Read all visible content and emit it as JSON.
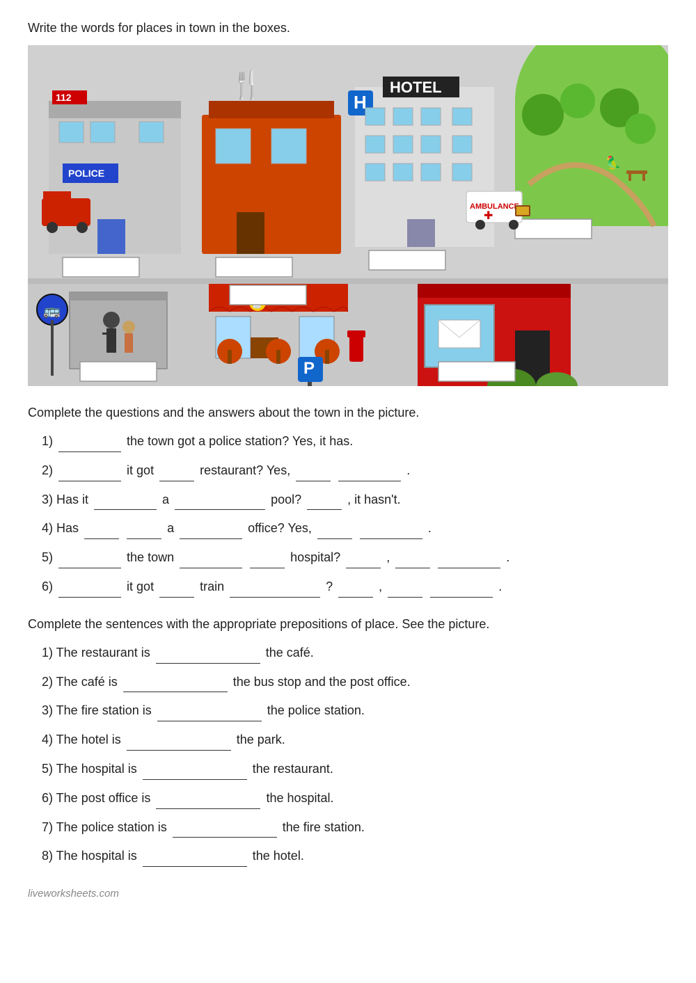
{
  "page": {
    "instruction1": "Write the words for places in town in the boxes.",
    "instruction2": "Complete the questions and the answers about the town in the picture.",
    "instruction3": "Complete the sentences with the appropriate prepositions of place. See the picture.",
    "footer": "liveworksheets.com"
  },
  "questions": [
    {
      "num": "1)",
      "text": "_________ the town got a police station?  Yes, it has."
    },
    {
      "num": "2)",
      "text": "_________ it got ____ restaurant? Yes, ____ _________."
    },
    {
      "num": "3)",
      "text": "Has it _________ a _______________ pool? _____, it hasn't."
    },
    {
      "num": "4)",
      "text": "Has _____ _______ a _________ office? Yes, ____ _________."
    },
    {
      "num": "5)",
      "text": "_________ the town _________ _____ hospital? _____, ____ _________."
    },
    {
      "num": "6)",
      "text": "_________ it got _____ train ___________ ? _____, ____ _________."
    }
  ],
  "sentences": [
    {
      "num": "1)",
      "text_before": "The restaurant is",
      "blank_size": "xl",
      "text_after": "the café."
    },
    {
      "num": "2)",
      "text_before": "The café is",
      "blank_size": "xl",
      "text_after": "the bus stop and the post office."
    },
    {
      "num": "3)",
      "text_before": "The fire station is",
      "blank_size": "xl",
      "text_after": "the police station."
    },
    {
      "num": "4)",
      "text_before": "The hotel is",
      "blank_size": "xl",
      "text_after": "the park."
    },
    {
      "num": "5)",
      "text_before": "The hospital is",
      "blank_size": "xl",
      "text_after": "the restaurant."
    },
    {
      "num": "6)",
      "text_before": "The post office is",
      "blank_size": "xl",
      "text_after": "the hospital."
    },
    {
      "num": "7)",
      "text_before": "The police station is",
      "blank_size": "xl",
      "text_after": "the fire station."
    },
    {
      "num": "8)",
      "text_before": "The hospital is",
      "blank_size": "xl",
      "text_after": "the hotel."
    }
  ]
}
